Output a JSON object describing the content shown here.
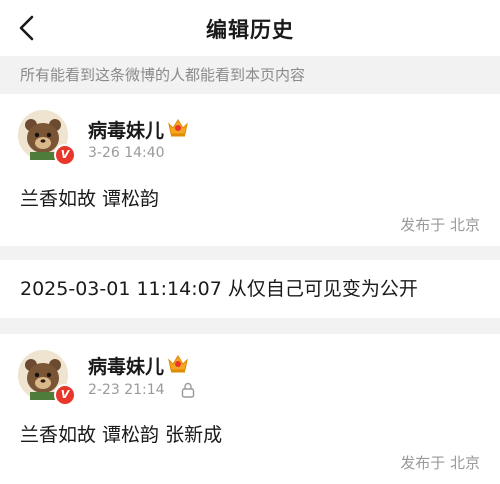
{
  "header": {
    "title": "编辑历史"
  },
  "notice": "所有能看到这条微博的人都能看到本页内容",
  "entries": [
    {
      "user": "病毒妹儿",
      "time": "3-26 14:40",
      "content": "兰香如故 谭松韵",
      "location": "发布于 北京"
    },
    {
      "user": "病毒妹儿",
      "time": "2-23 21:14",
      "content": "兰香如故 谭松韵 张新成",
      "location": "发布于 北京"
    }
  ],
  "visibility_change": "2025-03-01 11:14:07 从仅自己可见变为公开",
  "icons": {
    "back": "chevron-left-icon",
    "badge": "verified-v-icon",
    "member": "crown-icon",
    "privacy": "lock-icon"
  },
  "colors": {
    "verified_badge": "#e8362a",
    "crown": "#f5a623",
    "muted_text": "#9a9a9a",
    "separator": "#f2f2f2"
  }
}
